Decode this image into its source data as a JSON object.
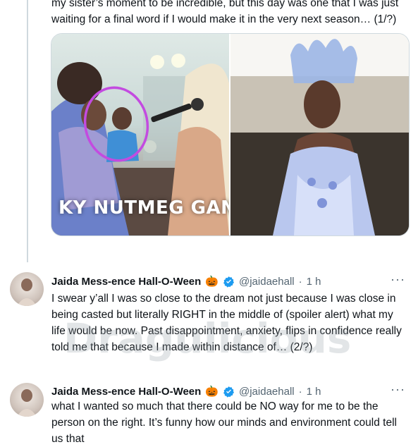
{
  "tweets": [
    {
      "text": "my sister’s moment to be incredible, but this day was one that I was just waiting for a final word if I would make it in the very next season… (1/?)",
      "media": {
        "caption": "KY NUTMEG GANAC"
      }
    },
    {
      "author_name": "Jaida Mess-ence Hall-O-Ween",
      "emoji": "🎃",
      "handle": "@jaidaehall",
      "separator": "·",
      "time": "1 h",
      "text": "I swear y’all I was so close to the dream not just because I was close in being casted but literally RIGHT in the middle of (spoiler alert) what my life would be now. Past disappointment, anxiety, flips in confidence really told me that because I made within distance of… (2/?)",
      "more": "···"
    },
    {
      "author_name": "Jaida Mess-ence Hall-O-Ween",
      "emoji": "🎃",
      "handle": "@jaidaehall",
      "separator": "·",
      "time": "1 h",
      "text": "what I wanted so much that there could be NO way for me to be the person on the right. It’s funny how our minds and environment could tell us that",
      "more": "···"
    }
  ],
  "watermark": "Dragulicious",
  "colors": {
    "verified": "#1d9bf0",
    "circle_annotation": "#c34be0",
    "thread_line": "#cfd9de",
    "secondary_text": "#536471"
  }
}
